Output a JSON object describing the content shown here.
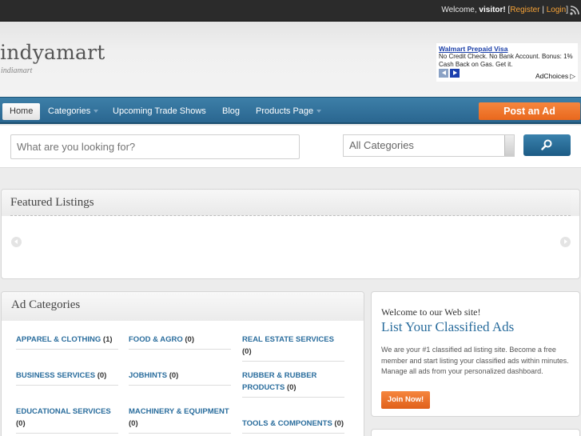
{
  "topbar": {
    "welcome_prefix": "Welcome,",
    "username": "visitor!",
    "bracket_open": "[",
    "register": "Register",
    "separator": "|",
    "login": "Login",
    "bracket_close": "]",
    "rss_icon": "rss-icon"
  },
  "header": {
    "logo": "indyamart",
    "tagline": "indiamart"
  },
  "ad": {
    "title": "Walmart Prepaid Visa",
    "body": "No Credit Check. No Bank Account. Bonus: 1% Cash Back on Gas. Get it.",
    "adchoices": "AdChoices"
  },
  "nav": {
    "items": [
      {
        "label": "Home"
      },
      {
        "label": "Categories"
      },
      {
        "label": "Upcoming Trade Shows"
      },
      {
        "label": "Blog"
      },
      {
        "label": "Products Page"
      }
    ],
    "post_ad": "Post an Ad"
  },
  "search": {
    "placeholder": "What are you looking for?",
    "category": "All Categories",
    "button_icon": "search-icon"
  },
  "featured": {
    "title": "Featured Listings"
  },
  "categories": {
    "title": "Ad Categories",
    "items": [
      {
        "name": "APPAREL & CLOTHING",
        "count": "(1)"
      },
      {
        "name": "FOOD & AGRO",
        "count": "(0)"
      },
      {
        "name": "REAL ESTATE SERVICES",
        "count": "(0)"
      },
      {
        "name": "BUSINESS SERVICES",
        "count": "(0)"
      },
      {
        "name": "JOBHINTS",
        "count": "(0)"
      },
      {
        "name": "RUBBER & RUBBER PRODUCTS",
        "count": "(0)"
      },
      {
        "name": "EDUCATIONAL SERVICES",
        "count": "(0)"
      },
      {
        "name": "MACHINERY & EQUIPMENT",
        "count": "(0)"
      },
      {
        "name": "TOOLS & COMPONENTS",
        "count": "(0)"
      }
    ]
  },
  "welcome": {
    "small_title": "Welcome to our Web site!",
    "big_title": "List Your Classified Ads",
    "desc": "We are your #1 classified ad listing site. Become a free member and start listing your classified ads within minutes. Manage all ads from your personalized dashboard.",
    "join": "Join Now!"
  },
  "colors": {
    "nav_bg": "#2f6f98",
    "accent_orange": "#ef7428",
    "link_blue": "#2a6d9d"
  }
}
